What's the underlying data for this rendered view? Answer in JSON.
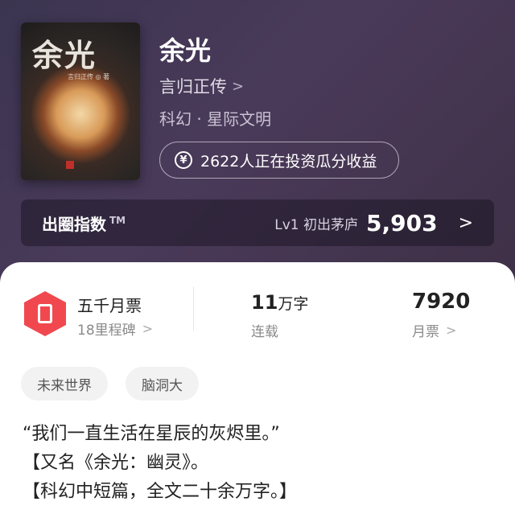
{
  "book": {
    "cover_title": "余光",
    "cover_author": "言归正传 ◎ 著",
    "title": "余光",
    "author": "言归正传",
    "genre": "科幻 · 星际文明"
  },
  "invest": {
    "text": "2622人正在投资瓜分收益",
    "icon": "yen-icon"
  },
  "index_bar": {
    "label": "出圈指数",
    "tm": "TM",
    "level_text": "Lv1 初出茅庐",
    "value": "5,903"
  },
  "stats": {
    "ticket_title": "五千月票",
    "ticket_sub": "18里程碑",
    "words_num": "11",
    "words_unit": "万字",
    "status": "连载",
    "monthly_num": "7920",
    "monthly_label": "月票"
  },
  "tags": [
    "未来世界",
    "脑洞大"
  ],
  "description": [
    "“我们一直生活在星辰的灰烬里。”",
    "【又名《余光：幽灵》。",
    "【科幻中短篇，全文二十余万字。】"
  ],
  "colors": {
    "accent": "#f0484e",
    "hero_bg": "#3b3550"
  }
}
